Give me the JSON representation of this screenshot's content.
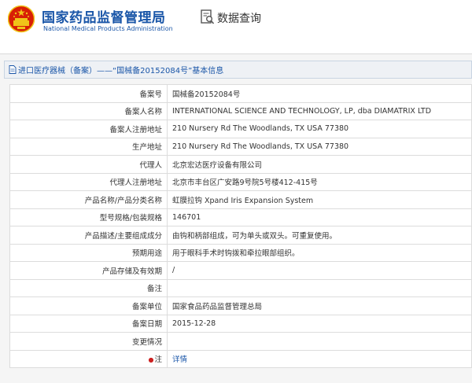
{
  "header": {
    "agency_cn": "国家药品监督管理局",
    "agency_en": "National Medical Products Administration",
    "query_title": "数据查询",
    "icons": {
      "emblem": "national-emblem",
      "query": "search-document-icon"
    },
    "colors": {
      "brand": "#1a56a8",
      "emblem_red": "#d81e06",
      "emblem_gold": "#f0c419"
    }
  },
  "record": {
    "title": "进口医疗器械（备案）——“国械备20152084号”基本信息",
    "title_icon": "document-icon",
    "rows": [
      {
        "label": "备案号",
        "value": "国械备20152084号"
      },
      {
        "label": "备案人名称",
        "value": "INTERNATIONAL SCIENCE AND TECHNOLOGY, LP, dba DIAMATRIX LTD"
      },
      {
        "label": "备案人注册地址",
        "value": "210 Nursery Rd The Woodlands, TX USA 77380"
      },
      {
        "label": "生产地址",
        "value": "210 Nursery Rd The Woodlands, TX USA 77380"
      },
      {
        "label": "代理人",
        "value": "北京宏达医疗设备有限公司"
      },
      {
        "label": "代理人注册地址",
        "value": "北京市丰台区广安路9号院5号楼412-415号"
      },
      {
        "label": "产品名称/产品分类名称",
        "value": "虹膜拉钩 Xpand Iris Expansion System"
      },
      {
        "label": "型号规格/包装规格",
        "value": "146701"
      },
      {
        "label": "产品描述/主要组成成分",
        "value": "由钩和柄部组成，可为单头或双头。可重复使用。"
      },
      {
        "label": "预期用途",
        "value": "用于眼科手术时钩拨和牵拉眼部组织。"
      },
      {
        "label": "产品存储及有效期",
        "value": "/"
      },
      {
        "label": "备注",
        "value": ""
      },
      {
        "label": "备案单位",
        "value": "国家食品药品监督管理总局"
      },
      {
        "label": "备案日期",
        "value": "2015-12-28"
      },
      {
        "label": "变更情况",
        "value": ""
      }
    ],
    "note": {
      "tip_icon": "●",
      "label": "注",
      "link_text": "详情"
    }
  }
}
